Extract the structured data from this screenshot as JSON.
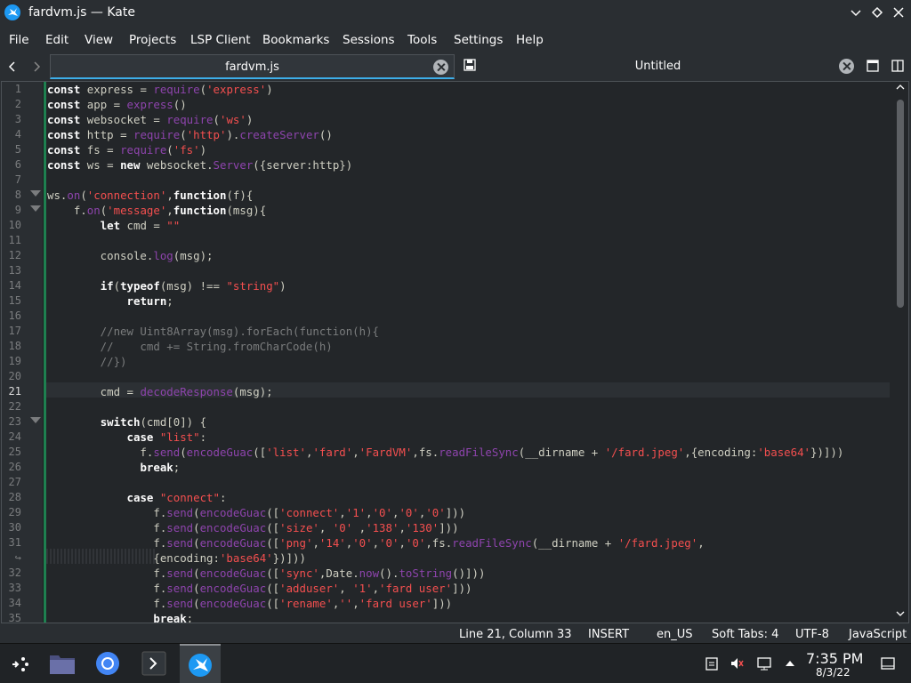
{
  "window": {
    "title": "fardvm.js — Kate"
  },
  "menu": [
    "File",
    "Edit",
    "View",
    "Projects",
    "LSP Client",
    "Bookmarks",
    "Sessions",
    "Tools",
    "Settings",
    "Help"
  ],
  "tabs": [
    {
      "label": "fardvm.js",
      "active": true
    },
    {
      "label": "Untitled",
      "active": false
    }
  ],
  "editor": {
    "line_numbers": [
      "1",
      "2",
      "3",
      "4",
      "5",
      "6",
      "7",
      "8",
      "9",
      "10",
      "11",
      "12",
      "13",
      "14",
      "15",
      "16",
      "17",
      "18",
      "19",
      "20",
      "21",
      "22",
      "23",
      "24",
      "25",
      "26",
      "27",
      "28",
      "29",
      "30",
      "31",
      "↪",
      "32",
      "33",
      "34",
      "35"
    ],
    "current_line": "21",
    "code": {
      "l1": "const express = require('express')",
      "l2": "const app = express()",
      "l3": "const websocket = require('ws')",
      "l4": "const http = require('http').createServer()",
      "l5": "const fs = require('fs')",
      "l6": "const ws = new websocket.Server({server:http})",
      "l8": "ws.on('connection',function(f){",
      "l9": "    f.on('message',function(msg){",
      "l10": "        let cmd = \"\"",
      "l12": "        console.log(msg);",
      "l14": "        if(typeof(msg) !== \"string\")",
      "l15": "            return;",
      "l17": "        //new Uint8Array(msg).forEach(function(h){",
      "l18": "        //    cmd += String.fromCharCode(h)",
      "l19": "        //})",
      "l21": "        cmd = decodeResponse(msg);",
      "l23": "        switch(cmd[0]) {",
      "l24": "            case \"list\":",
      "l25": "              f.send(encodeGuac(['list','fard','FardVM',fs.readFileSync(__dirname + '/fard.jpeg',{encoding:'base64'})]))",
      "l26": "              break;",
      "l28": "            case \"connect\":",
      "l29": "                f.send(encodeGuac(['connect','1','0','0','0']))",
      "l30": "                f.send(encodeGuac(['size', '0' ,'138','130']))",
      "l31": "                f.send(encodeGuac(['png','14','0','0','0',fs.readFileSync(__dirname + '/fard.jpeg',",
      "l31w": "                {encoding:'base64'})]))",
      "l32": "                f.send(encodeGuac(['sync',Date.now().toString()]))",
      "l33": "                f.send(encodeGuac(['adduser', '1','fard user']))",
      "l34": "                f.send(encodeGuac(['rename','','fard user']))",
      "l35": "                break;"
    }
  },
  "status": {
    "position": "Line 21, Column 33",
    "mode": "INSERT",
    "language_dict": "en_US",
    "indent": "Soft Tabs: 4",
    "encoding": "UTF-8",
    "syntax": "JavaScript"
  },
  "clock": {
    "time": "7:35 PM",
    "date": "8/3/22"
  },
  "colors": {
    "accent": "#3daee9",
    "keyword": "#fcfcfc",
    "string": "#f44f4f",
    "function": "#8e44ad",
    "comment": "#7a7c7d",
    "modified": "#1e8050"
  },
  "icons": [
    "kate-icon",
    "chevron-down-icon",
    "diamond-icon",
    "close-icon",
    "arrow-left-icon",
    "arrow-right-icon",
    "save-icon",
    "new-tab-icon",
    "split-view-icon",
    "app-launcher-icon",
    "folder-icon",
    "browser-icon",
    "terminal-icon",
    "clipboard-icon",
    "mute-icon",
    "network-icon",
    "tray-arrow-icon",
    "show-desktop-icon"
  ]
}
